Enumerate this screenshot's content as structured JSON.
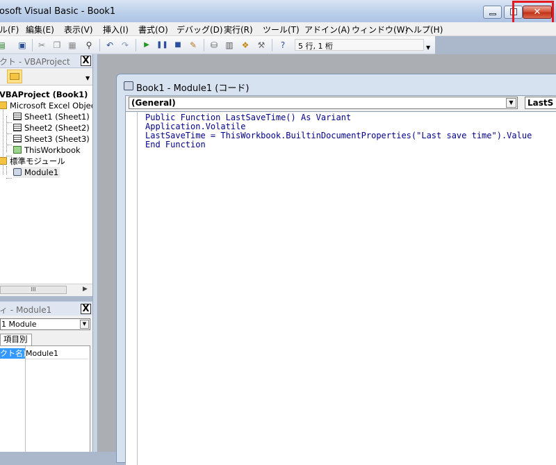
{
  "window": {
    "title": "osoft Visual Basic - Book1"
  },
  "menu": [
    {
      "id": "file",
      "label": "ル(F)"
    },
    {
      "id": "edit",
      "label": "編集(E)"
    },
    {
      "id": "view",
      "label": "表示(V)"
    },
    {
      "id": "insert",
      "label": "挿入(I)"
    },
    {
      "id": "format",
      "label": "書式(O)"
    },
    {
      "id": "debug",
      "label": "デバッグ(D)"
    },
    {
      "id": "run",
      "label": "実行(R)"
    },
    {
      "id": "tools",
      "label": "ツール(T)"
    },
    {
      "id": "addins",
      "label": "アドイン(A)"
    },
    {
      "id": "window",
      "label": "ウィンドウ(W)"
    },
    {
      "id": "help",
      "label": "ヘルプ(H)"
    }
  ],
  "toolbar": {
    "cursor_position": "5 行, 1 桁",
    "icons": [
      "view-excel-icon",
      "save-icon",
      "cut-icon",
      "copy-icon",
      "paste-icon",
      "find-icon",
      "undo-icon",
      "redo-icon",
      "run-icon",
      "break-icon",
      "reset-icon",
      "design-mode-icon",
      "project-explorer-icon",
      "properties-icon",
      "object-browser-icon",
      "toolbox-icon",
      "help-icon"
    ]
  },
  "project_pane": {
    "title": "クト - VBAProject",
    "close_label": "X",
    "tree": [
      {
        "label": "VBAProject (Book1)",
        "icon": "project-icon",
        "bold": true
      },
      {
        "label": "Microsoft Excel Object",
        "icon": "folder-icon"
      },
      {
        "label": "Sheet1 (Sheet1)",
        "icon": "sheet-icon"
      },
      {
        "label": "Sheet2 (Sheet2)",
        "icon": "sheet-icon"
      },
      {
        "label": "Sheet3 (Sheet3)",
        "icon": "sheet-icon"
      },
      {
        "label": "ThisWorkbook",
        "icon": "workbook-icon"
      },
      {
        "label": "標準モジュール",
        "icon": "folder-icon"
      },
      {
        "label": "Module1",
        "icon": "module-icon"
      }
    ]
  },
  "properties_pane": {
    "title": "ィ - Module1",
    "close_label": "X",
    "object_combo": "1 Module",
    "tab_label": "項目別",
    "property_name": "クト名)",
    "property_value": "Module1"
  },
  "code_window": {
    "title": "Book1 - Module1 (コード)",
    "object_combo": "(General)",
    "proc_combo": "LastS",
    "lines": [
      "Public Function LastSaveTime() As Variant",
      "Application.Volatile",
      "LastSaveTime = ThisWorkbook.BuiltinDocumentProperties(\"Last save time\").Value",
      "End Function"
    ]
  },
  "colors": {
    "highlight_box": "#e5171f",
    "close_button": "#c23216",
    "keyword": "#00008b"
  }
}
